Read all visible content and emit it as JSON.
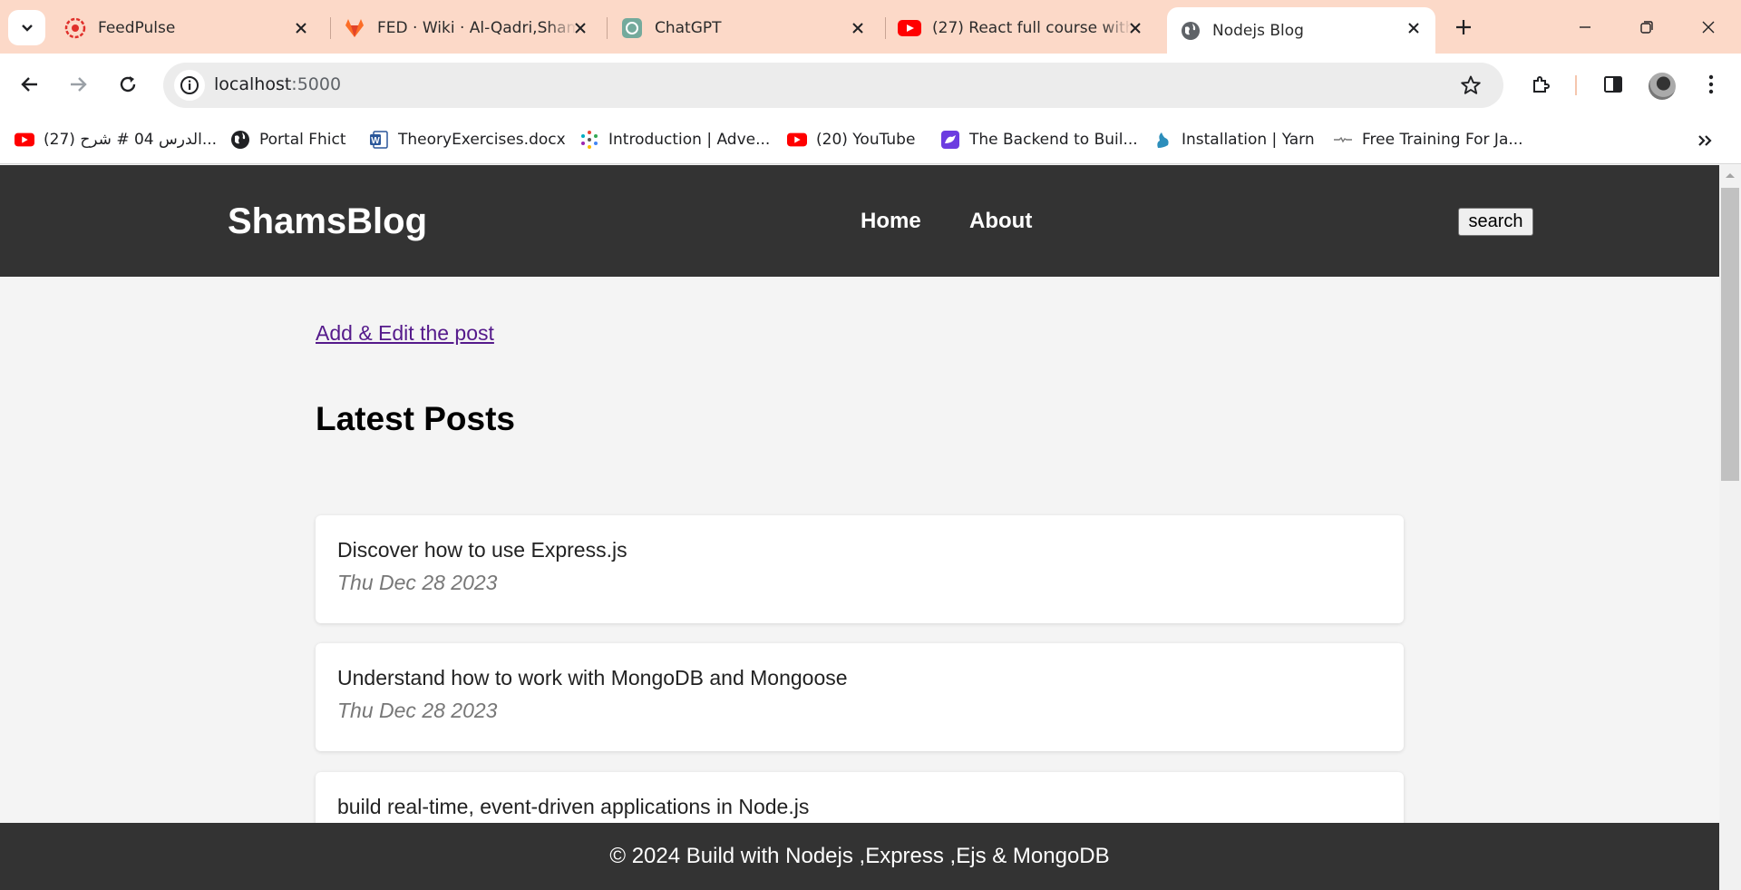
{
  "browser": {
    "tabs": [
      {
        "title": "FeedPulse",
        "icon": "feedpulse-icon",
        "active": false
      },
      {
        "title": "FED · Wiki · Al-Qadri,Sham",
        "icon": "gitlab-icon",
        "active": false
      },
      {
        "title": "ChatGPT",
        "icon": "chatgpt-icon",
        "active": false
      },
      {
        "title": "(27) React full course with",
        "icon": "youtube-icon",
        "active": false
      },
      {
        "title": "Nodejs Blog",
        "icon": "globe-icon",
        "active": true
      }
    ],
    "url": {
      "host": "localhost",
      "port": ":5000"
    },
    "bookmarks": [
      {
        "label": "(27) الدرس 04 # شرح...",
        "icon": "youtube-icon"
      },
      {
        "label": "Portal Fhict",
        "icon": "globe-icon"
      },
      {
        "label": "TheoryExercises.docx",
        "icon": "word-icon"
      },
      {
        "label": "Introduction | Adve...",
        "icon": "dots-icon"
      },
      {
        "label": "(20) YouTube",
        "icon": "youtube-icon"
      },
      {
        "label": "The Backend to Buil...",
        "icon": "backend-icon"
      },
      {
        "label": "Installation | Yarn",
        "icon": "yarn-icon"
      },
      {
        "label": "Free Training For Ja...",
        "icon": "training-icon"
      }
    ],
    "colors": {
      "tabbar": "#fcd9c8",
      "youtube": "#ff0000"
    }
  },
  "site": {
    "logo": "ShamsBlog",
    "nav": {
      "home": "Home",
      "about": "About"
    },
    "search_label": "search",
    "add_edit_link": "Add & Edit the post",
    "latest_heading": "Latest Posts",
    "posts": [
      {
        "title": "Discover how to use Express.js",
        "date": "Thu Dec 28 2023"
      },
      {
        "title": "Understand how to work with MongoDB and Mongoose",
        "date": "Thu Dec 28 2023"
      },
      {
        "title": "build real-time, event-driven applications in Node.js",
        "date": ""
      }
    ],
    "footer": "© 2024 Build with Nodejs ,Express ,Ejs & MongoDB",
    "colors": {
      "header_bg": "#333333",
      "page_bg": "#f4f4f4",
      "link": "#551a8b"
    }
  }
}
